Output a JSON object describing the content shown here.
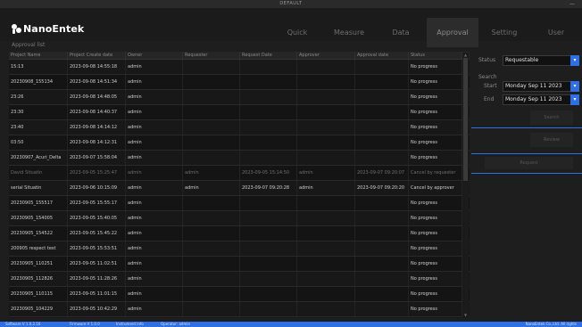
{
  "window": {
    "title": "DEFAULT",
    "minimize": "—"
  },
  "brand": {
    "name": "NanoEntek"
  },
  "nav": {
    "tabs": [
      "Quick",
      "Measure",
      "Data",
      "Approval",
      "Setting",
      "User"
    ],
    "active": "Approval"
  },
  "breadcrumb": "Approval list",
  "table": {
    "columns": [
      "Project Name",
      "Project Create date",
      "Owner",
      "Requester",
      "Request Date",
      "Approver",
      "Approval date",
      "Status"
    ],
    "rows": [
      [
        "15:13",
        "2023-09-08 14:55:18",
        "admin",
        "",
        "",
        "",
        "",
        "No progress"
      ],
      [
        "20230908_155134",
        "2023-09-08 14:51:34",
        "admin",
        "",
        "",
        "",
        "",
        "No progress"
      ],
      [
        "23:26",
        "2023-09-08 14:48:05",
        "admin",
        "",
        "",
        "",
        "",
        "No progress"
      ],
      [
        "23:30",
        "2023-09-08 14:40:37",
        "admin",
        "",
        "",
        "",
        "",
        "No progress"
      ],
      [
        "23:40",
        "2023-09-08 14:14:12",
        "admin",
        "",
        "",
        "",
        "",
        "No progress"
      ],
      [
        "03:50",
        "2023-09-08 14:12:31",
        "admin",
        "",
        "",
        "",
        "",
        "No progress"
      ],
      [
        "20230907_Acuri_Delta",
        "2023-09-07 15:58:04",
        "admin",
        "",
        "",
        "",
        "",
        "No progress"
      ],
      [
        "David Situatin",
        "2023-09-05 15:25:47",
        "admin",
        "admin",
        "2023-09-05 15:14:50",
        "admin",
        "2023-09-07 09:20:07",
        "Cancel by requester"
      ],
      [
        "serial Situatin",
        "2023-09-06 10:15:09",
        "admin",
        "admin",
        "2023-09-07 09:20:28",
        "admin",
        "2023-09-07 09:20:20",
        "Cancel by approver"
      ],
      [
        "20230905_155517",
        "2023-09-05 15:55:17",
        "admin",
        "",
        "",
        "",
        "",
        "No progress"
      ],
      [
        "20230905_154005",
        "2023-09-05 15:40:05",
        "admin",
        "",
        "",
        "",
        "",
        "No progress"
      ],
      [
        "20230905_154522",
        "2023-09-05 15:45:22",
        "admin",
        "",
        "",
        "",
        "",
        "No progress"
      ],
      [
        "200905 respect test",
        "2023-09-05 15:53:51",
        "admin",
        "",
        "",
        "",
        "",
        "No progress"
      ],
      [
        "20230905_110251",
        "2023-09-05 11:02:51",
        "admin",
        "",
        "",
        "",
        "",
        "No progress"
      ],
      [
        "20230905_112826",
        "2023-09-05 11:28:26",
        "admin",
        "",
        "",
        "",
        "",
        "No progress"
      ],
      [
        "20230905_110115",
        "2023-09-05 11:01:15",
        "admin",
        "",
        "",
        "",
        "",
        "No progress"
      ],
      [
        "20230905_104229",
        "2023-09-05 10:42:29",
        "admin",
        "",
        "",
        "",
        "",
        "No progress"
      ]
    ]
  },
  "filters": {
    "status_label": "Status",
    "status_value": "Requestable",
    "search_label": "Search",
    "start_label": "Start",
    "start_value": "Monday Sep 11 2023",
    "end_label": "End",
    "end_value": "Monday Sep 11 2023",
    "search_button": "Search",
    "review_button": "Review",
    "request_button": "Request"
  },
  "footer": {
    "items": [
      "Software V 1.0.2.16",
      "Firmware V 1.0.0",
      "Instrument info",
      "Operator: admin",
      "NanoEntek Co.,Ltd. All rights"
    ]
  },
  "colors": {
    "accent": "#2f6fe6",
    "background": "#1e1e1e"
  }
}
